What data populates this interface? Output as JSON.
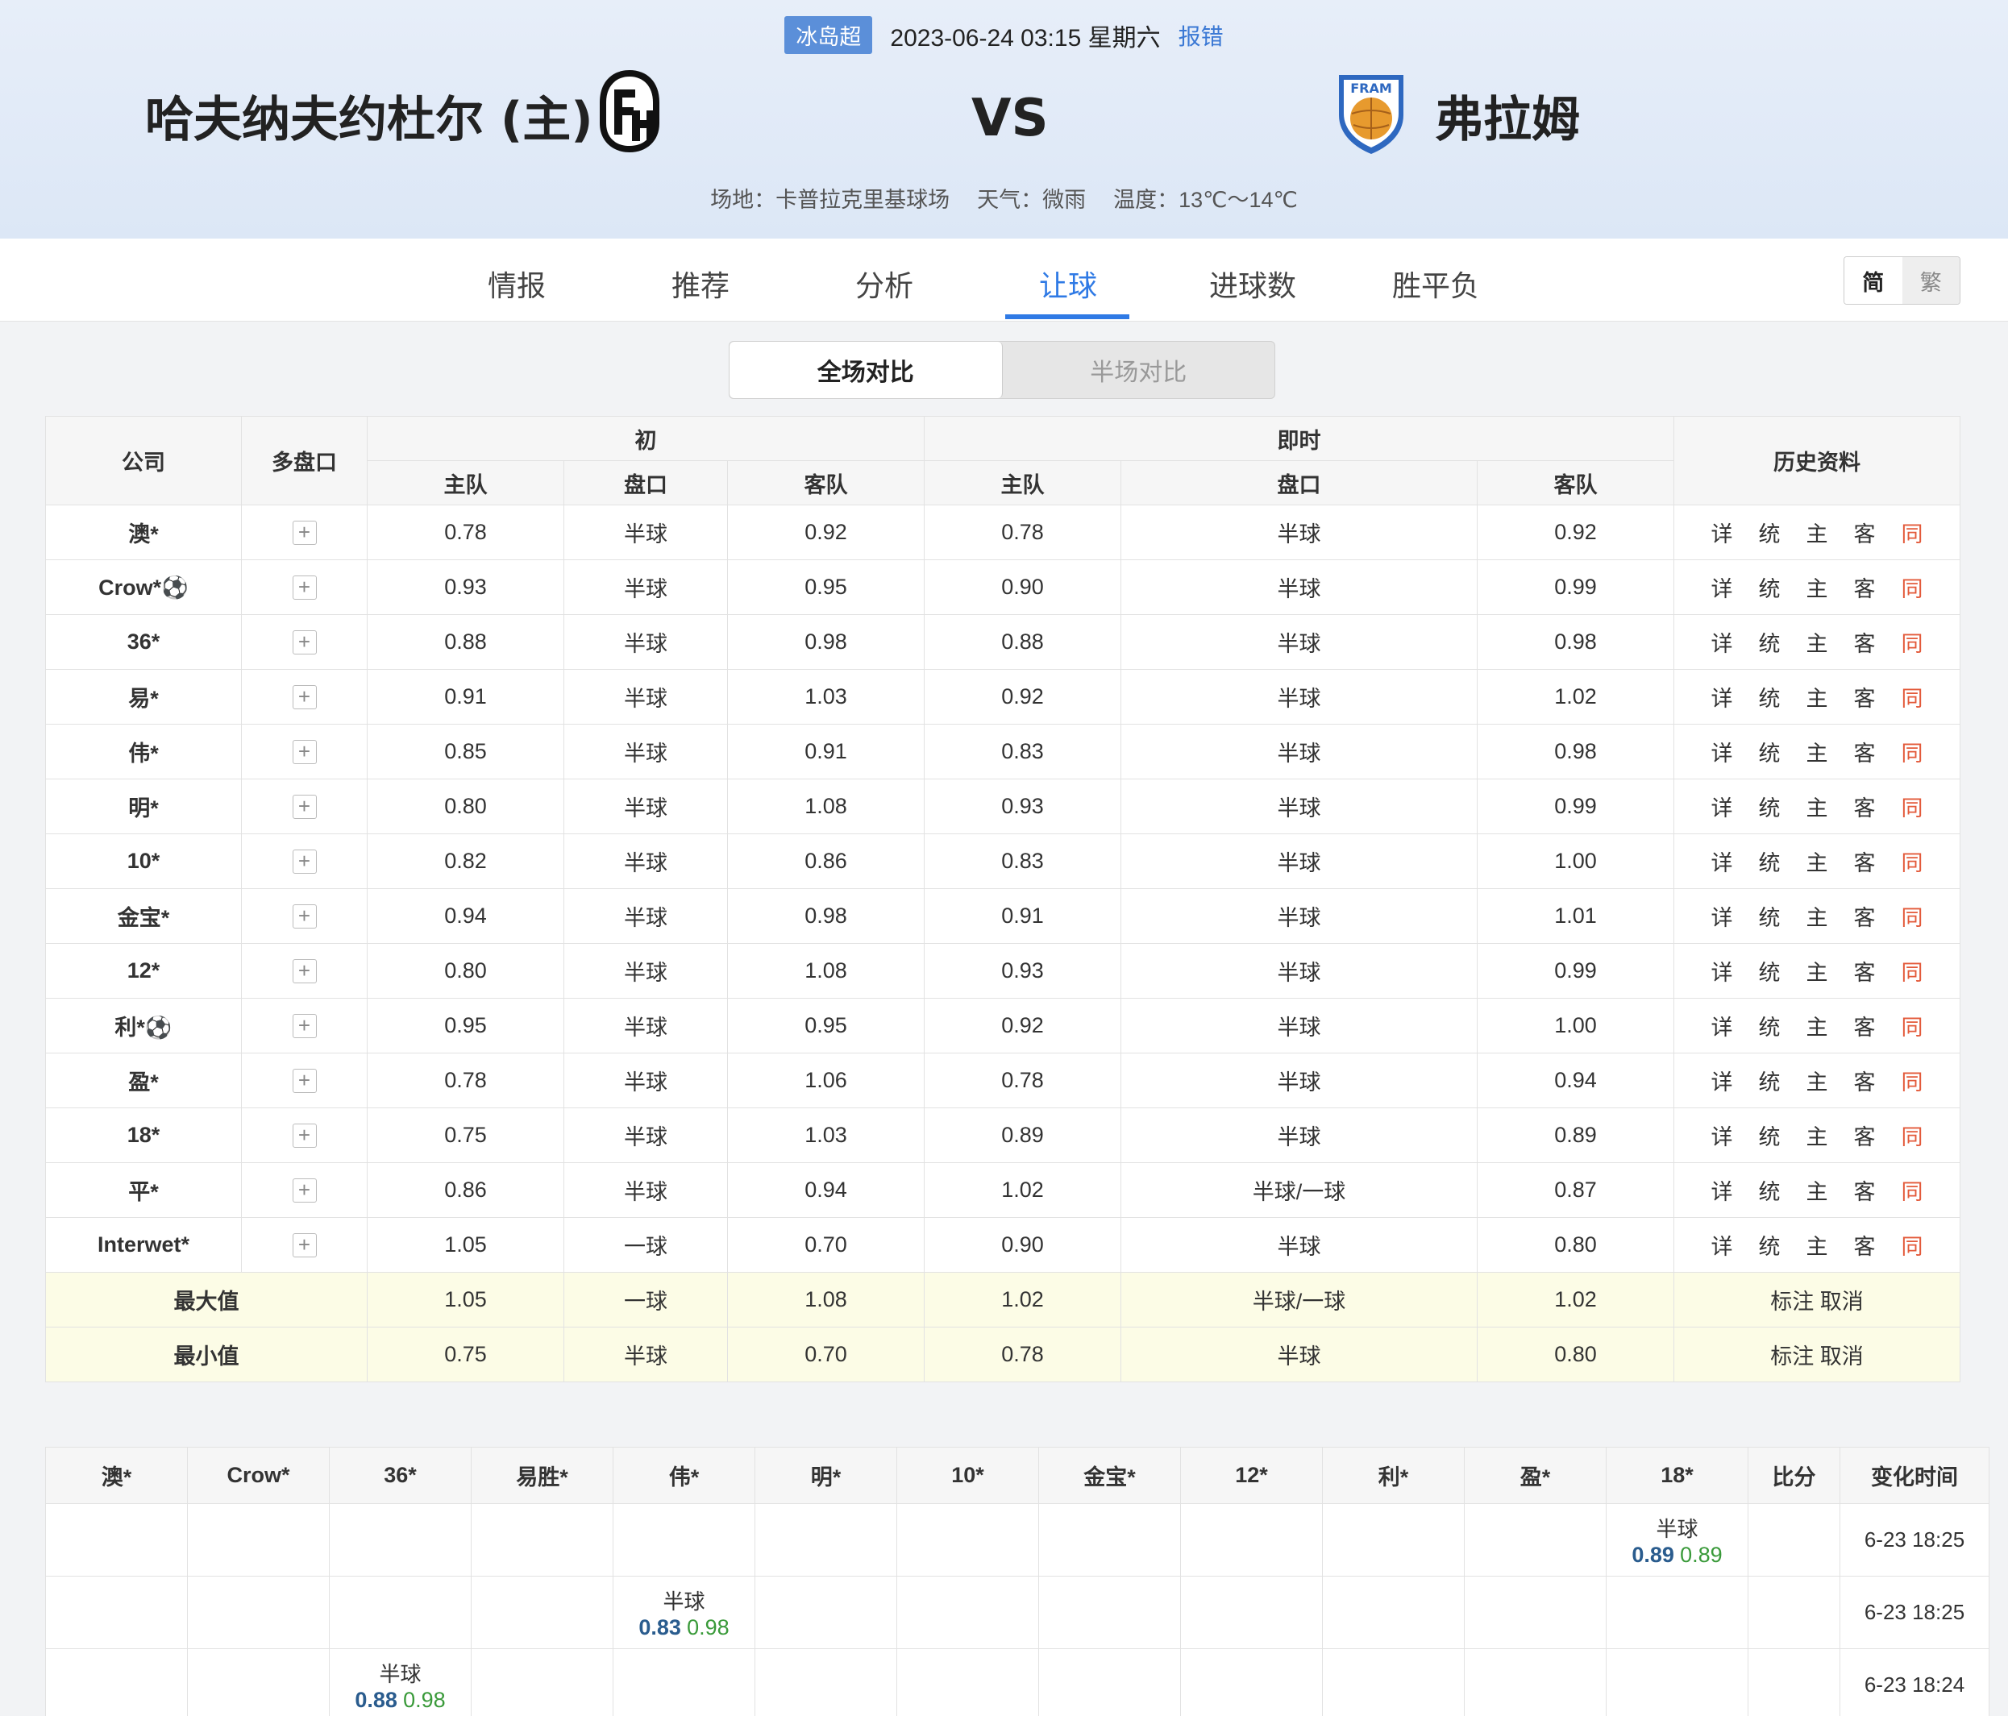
{
  "header": {
    "league": "冰岛超",
    "datetime": "2023-06-24 03:15 星期六",
    "report": "报错",
    "home_team": "哈夫纳夫约杜尔 (主)",
    "vs": "VS",
    "away_team": "弗拉姆",
    "venue": "场地：卡普拉克里基球场",
    "weather": "天气：微雨",
    "temperature": "温度：13℃～14℃"
  },
  "nav": {
    "tabs": [
      "情报",
      "推荐",
      "分析",
      "让球",
      "进球数",
      "胜平负"
    ],
    "active": "让球",
    "simplified": "简",
    "traditional": "繁"
  },
  "segment": {
    "full": "全场对比",
    "half": "半场对比"
  },
  "odds_table": {
    "headers": {
      "company": "公司",
      "multi": "多盘口",
      "initial": "初",
      "live": "即时",
      "history": "历史资料",
      "home": "主队",
      "line": "盘口",
      "away": "客队"
    },
    "history_links": [
      "详",
      "统",
      "主",
      "客",
      "同"
    ],
    "rows": [
      {
        "company": "澳*",
        "i_home": "0.78",
        "i_line": "半球",
        "i_away": "0.92",
        "l_home": "0.78",
        "l_line": "半球",
        "l_away": "0.92"
      },
      {
        "company": "Crow*⚽",
        "i_home": "0.93",
        "i_line": "半球",
        "i_away": "0.95",
        "l_home": "0.90",
        "l_line": "半球",
        "l_away": "0.99"
      },
      {
        "company": "36*",
        "i_home": "0.88",
        "i_line": "半球",
        "i_away": "0.98",
        "l_home": "0.88",
        "l_line": "半球",
        "l_away": "0.98"
      },
      {
        "company": "易*",
        "i_home": "0.91",
        "i_line": "半球",
        "i_away": "1.03",
        "l_home": "0.92",
        "l_line": "半球",
        "l_away": "1.02"
      },
      {
        "company": "伟*",
        "i_home": "0.85",
        "i_line": "半球",
        "i_away": "0.91",
        "l_home": "0.83",
        "l_line": "半球",
        "l_away": "0.98"
      },
      {
        "company": "明*",
        "i_home": "0.80",
        "i_line": "半球",
        "i_away": "1.08",
        "l_home": "0.93",
        "l_line": "半球",
        "l_away": "0.99"
      },
      {
        "company": "10*",
        "i_home": "0.82",
        "i_line": "半球",
        "i_away": "0.86",
        "l_home": "0.83",
        "l_line": "半球",
        "l_away": "1.00"
      },
      {
        "company": "金宝*",
        "i_home": "0.94",
        "i_line": "半球",
        "i_away": "0.98",
        "l_home": "0.91",
        "l_line": "半球",
        "l_away": "1.01"
      },
      {
        "company": "12*",
        "i_home": "0.80",
        "i_line": "半球",
        "i_away": "1.08",
        "l_home": "0.93",
        "l_line": "半球",
        "l_away": "0.99"
      },
      {
        "company": "利*⚽",
        "i_home": "0.95",
        "i_line": "半球",
        "i_away": "0.95",
        "l_home": "0.92",
        "l_line": "半球",
        "l_away": "1.00"
      },
      {
        "company": "盈*",
        "i_home": "0.78",
        "i_line": "半球",
        "i_away": "1.06",
        "l_home": "0.78",
        "l_line": "半球",
        "l_away": "0.94"
      },
      {
        "company": "18*",
        "i_home": "0.75",
        "i_line": "半球",
        "i_away": "1.03",
        "l_home": "0.89",
        "l_line": "半球",
        "l_away": "0.89"
      },
      {
        "company": "平*",
        "i_home": "0.86",
        "i_line": "半球",
        "i_away": "0.94",
        "l_home": "1.02",
        "l_line": "半球/一球",
        "l_away": "0.87"
      },
      {
        "company": "Interwet*",
        "i_home": "1.05",
        "i_line": "一球",
        "i_away": "0.70",
        "l_home": "0.90",
        "l_line": "半球",
        "l_away": "0.80"
      }
    ],
    "summary": [
      {
        "label": "最大值",
        "i_home": "1.05",
        "i_line": "一球",
        "i_away": "1.08",
        "l_home": "1.02",
        "l_line": "半球/一球",
        "l_away": "1.02",
        "action": "标注 取消"
      },
      {
        "label": "最小值",
        "i_home": "0.75",
        "i_line": "半球",
        "i_away": "0.70",
        "l_home": "0.78",
        "l_line": "半球",
        "l_away": "0.80",
        "action": "标注 取消"
      }
    ]
  },
  "change_table": {
    "headers": [
      "澳*",
      "Crow*",
      "36*",
      "易胜*",
      "伟*",
      "明*",
      "10*",
      "金宝*",
      "12*",
      "利*",
      "盈*",
      "18*",
      "比分",
      "变化时间"
    ],
    "rows": [
      {
        "col": 11,
        "line": "半球",
        "home": "0.89",
        "away": "0.89",
        "time": "6-23 18:25"
      },
      {
        "col": 4,
        "line": "半球",
        "home": "0.83",
        "away": "0.98",
        "time": "6-23 18:25"
      },
      {
        "col": 2,
        "line": "半球",
        "home": "0.88",
        "away": "0.98",
        "time": "6-23 18:24"
      }
    ]
  },
  "colors": {
    "accent": "#2f7ae5",
    "league_badge": "#5b8fd9",
    "history_red": "#e35a3a",
    "home_odds": "#2a5c8e",
    "away_odds": "#3a9a3a",
    "summary_bg": "#fcfce6"
  }
}
